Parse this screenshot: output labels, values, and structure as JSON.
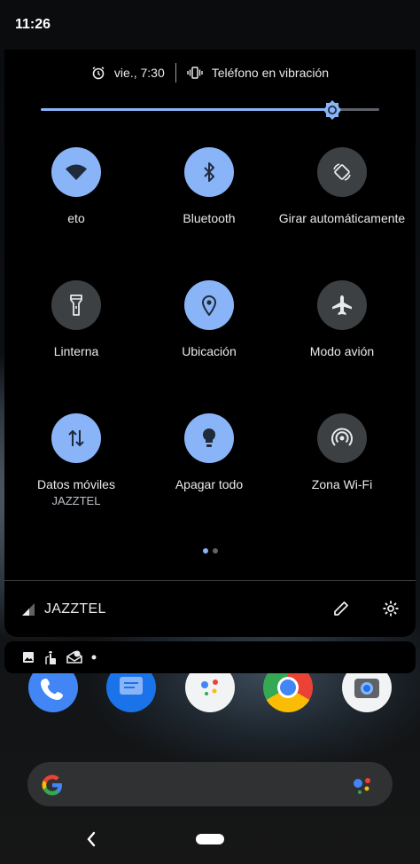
{
  "status_bar": {
    "time": "11:26"
  },
  "header": {
    "alarm": "vie., 7:30",
    "ringer": "Teléfono en vibración"
  },
  "brightness": {
    "level": 0.86
  },
  "tiles": [
    {
      "label": "eto",
      "icon": "wifi-icon",
      "state": "on"
    },
    {
      "label": "Bluetooth",
      "icon": "bluetooth-icon",
      "state": "on"
    },
    {
      "label": "Girar automáticamente",
      "icon": "rotate-icon",
      "state": "off"
    },
    {
      "label": "Linterna",
      "icon": "flashlight-icon",
      "state": "off"
    },
    {
      "label": "Ubicación",
      "icon": "location-icon",
      "state": "on"
    },
    {
      "label": "Modo avión",
      "icon": "airplane-icon",
      "state": "off"
    },
    {
      "label": "Datos móviles",
      "sublabel": "JAZZTEL",
      "icon": "mobile-data-icon",
      "state": "on"
    },
    {
      "label": "Apagar todo",
      "icon": "bulb-icon",
      "state": "on"
    },
    {
      "label": "Zona Wi-Fi",
      "icon": "hotspot-icon",
      "state": "off"
    }
  ],
  "page_indicator": {
    "current": 1,
    "total": 2
  },
  "footer": {
    "carrier": "JAZZTEL"
  },
  "notification_icons": [
    "image-icon",
    "touch-icon",
    "mail-icon",
    "dot-icon"
  ],
  "colors": {
    "accent": "#8ab4f8",
    "tile_off": "#3c4043",
    "panel": "#000000"
  }
}
